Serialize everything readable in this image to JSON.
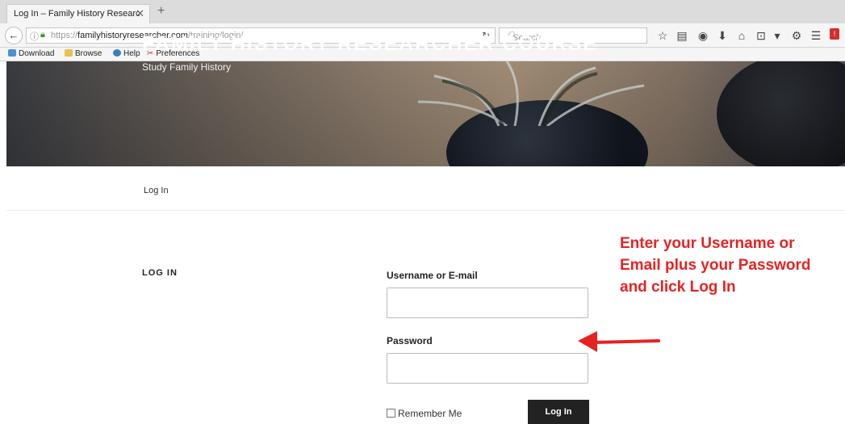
{
  "browser": {
    "tab_title": "Log In – Family History Researc",
    "tab_close": "✕",
    "new_tab": "+",
    "url_prefix": "https://",
    "url_domain": "familyhistoryresearcher.com",
    "url_path": "/training/login/",
    "search_placeholder": "Search",
    "notification_count": "!",
    "bookmarks": [
      {
        "label": "Download"
      },
      {
        "label": "Browse"
      },
      {
        "label": "Help"
      },
      {
        "label": "Preferences"
      }
    ]
  },
  "header": {
    "site_title": "FAMILY HISTORY RESEARCHER COURSE",
    "tagline": "Study Family History"
  },
  "nav": {
    "login_link": "Log In"
  },
  "main": {
    "section_title": "LOG IN",
    "username_label": "Username or E-mail",
    "password_label": "Password",
    "remember_label": "Remember Me",
    "login_button": "Log In"
  },
  "annotation": {
    "text": "Enter your Username or Email plus your Password and click Log In",
    "color": "#e52323"
  },
  "colors": {
    "button_bg": "#222222",
    "annotation": "#e52323"
  }
}
